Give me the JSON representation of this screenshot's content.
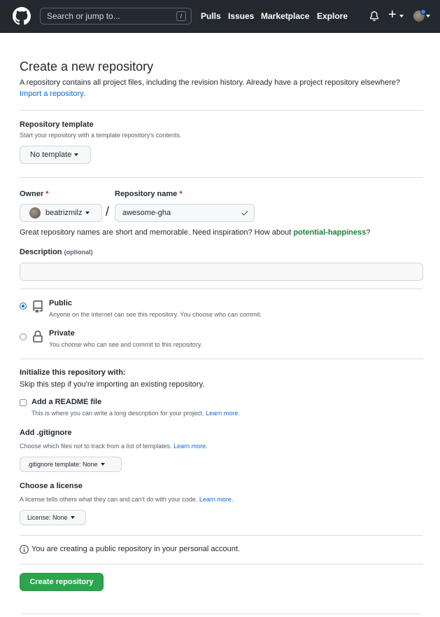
{
  "header": {
    "search_placeholder": "Search or jump to...",
    "search_shortcut": "/",
    "nav": [
      "Pulls",
      "Issues",
      "Marketplace",
      "Explore"
    ]
  },
  "page": {
    "title": "Create a new repository",
    "intro_text": "A repository contains all project files, including the revision history. Already have a project repository elsewhere?",
    "import_link": "Import a repository."
  },
  "template": {
    "label": "Repository template",
    "note": "Start your repository with a template repository's contents.",
    "button": "No template"
  },
  "owner": {
    "label": "Owner",
    "required_mark": "*",
    "value": "beatrizmilz"
  },
  "separator": "/",
  "repo_name": {
    "label": "Repository name",
    "required_mark": "*",
    "value": "awesome-gha"
  },
  "name_hint": {
    "text": "Great repository names are short and memorable. Need inspiration? How about",
    "suggestion": "potential-happiness",
    "end": "?"
  },
  "description": {
    "label": "Description",
    "optional": "(optional)",
    "value": ""
  },
  "visibility": {
    "public": {
      "title": "Public",
      "note": "Anyone on the internet can see this repository. You choose who can commit.",
      "selected": true
    },
    "private": {
      "title": "Private",
      "note": "You choose who can see and commit to this repository.",
      "selected": false
    }
  },
  "initialize": {
    "heading": "Initialize this repository with:",
    "note": "Skip this step if you're importing an existing repository.",
    "readme_label": "Add a README file",
    "readme_note": "This is where you can write a long description for your project.",
    "learn_more": "Learn more."
  },
  "gitignore": {
    "label": "Add .gitignore",
    "note": "Choose which files not to track from a list of templates.",
    "learn_more": "Learn more.",
    "button": ".gitignore template: None"
  },
  "license": {
    "label": "Choose a license",
    "note": "A license tells others what they can and can't do with your code.",
    "learn_more": "Learn more.",
    "button": "License: None"
  },
  "info": {
    "text": "You are creating a public repository in your personal account."
  },
  "submit": {
    "label": "Create repository"
  },
  "colors": {
    "header_bg": "#24292f",
    "link": "#0969da",
    "success": "#1a7f37",
    "primary_button": "#2da44e",
    "required": "#cf222e"
  }
}
